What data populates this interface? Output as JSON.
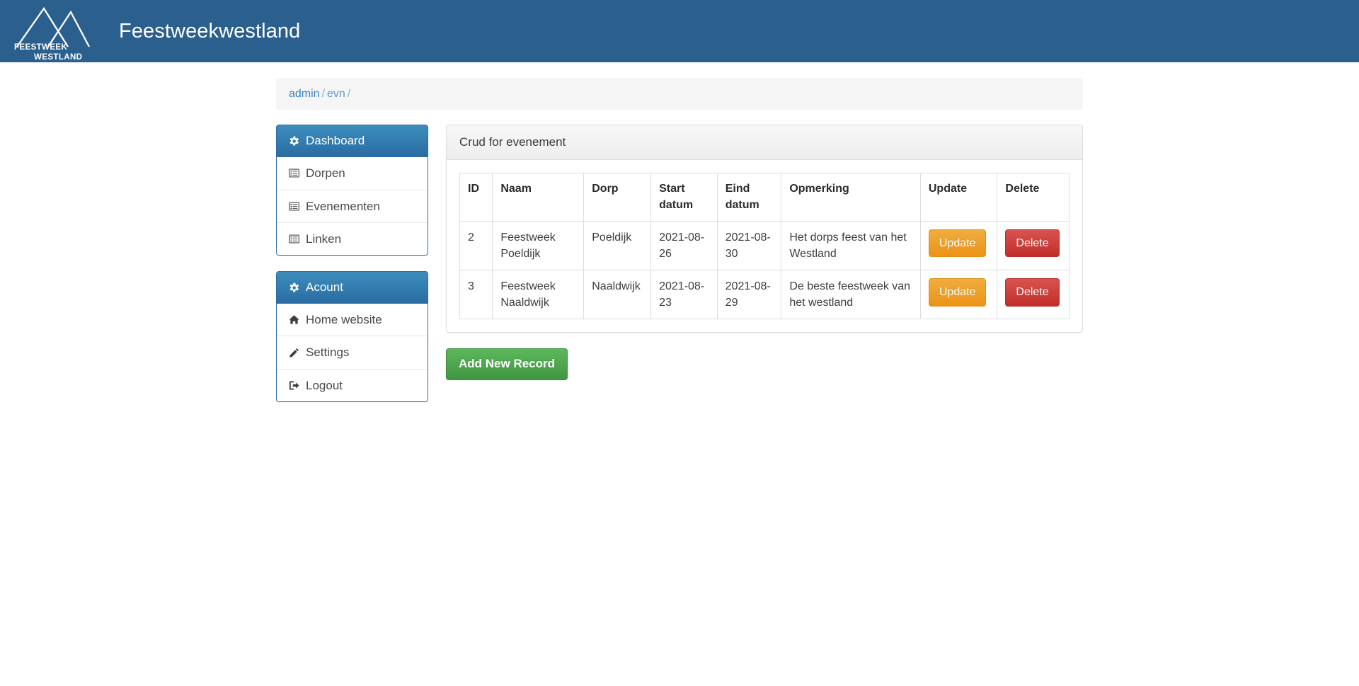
{
  "navbar": {
    "brand_title": "Feestweekwestland",
    "logo_text_top": "FEESTWEEK",
    "logo_text_bottom": "WESTLAND",
    "background_color": "#2b5f8e"
  },
  "breadcrumb": {
    "root_label": "admin",
    "sep1": "/",
    "second_label": "evn",
    "sep2": "/"
  },
  "sidebar": {
    "dashboard_panel": {
      "heading": "Dashboard",
      "heading_icon": "gear-icon",
      "items": [
        {
          "label": "Dorpen",
          "icon": "list-alt-icon"
        },
        {
          "label": "Evenementen",
          "icon": "list-alt-icon"
        },
        {
          "label": "Linken",
          "icon": "list-alt-icon"
        }
      ]
    },
    "account_panel": {
      "heading": "Acount",
      "heading_icon": "gear-icon",
      "items": [
        {
          "label": "Home website",
          "icon": "home-icon"
        },
        {
          "label": "Settings",
          "icon": "pencil-icon"
        },
        {
          "label": "Logout",
          "icon": "sign-out-icon"
        }
      ]
    }
  },
  "main": {
    "panel_heading": "Crud for evenement",
    "table": {
      "columns": [
        "ID",
        "Naam",
        "Dorp",
        "Start datum",
        "Eind datum",
        "Opmerking",
        "Update",
        "Delete"
      ],
      "rows": [
        {
          "id": "2",
          "naam": "Feestweek Poeldijk",
          "dorp": "Poeldijk",
          "start_datum": "2021-08-26",
          "eind_datum": "2021-08-30",
          "opmerking": "Het dorps feest van het Westland",
          "update_label": "Update",
          "delete_label": "Delete"
        },
        {
          "id": "3",
          "naam": "Feestweek Naaldwijk",
          "dorp": "Naaldwijk",
          "start_datum": "2021-08-23",
          "eind_datum": "2021-08-29",
          "opmerking": "De beste feestweek van het westland",
          "update_label": "Update",
          "delete_label": "Delete"
        }
      ]
    },
    "add_button_label": "Add New Record"
  },
  "colors": {
    "navbar_blue": "#2b5f8e",
    "panel_blue": "#337ab7",
    "update_orange": "#ef9a1e",
    "delete_red": "#ce3b37",
    "add_green": "#4cae4c",
    "link_blue": "#3c7ebf"
  }
}
